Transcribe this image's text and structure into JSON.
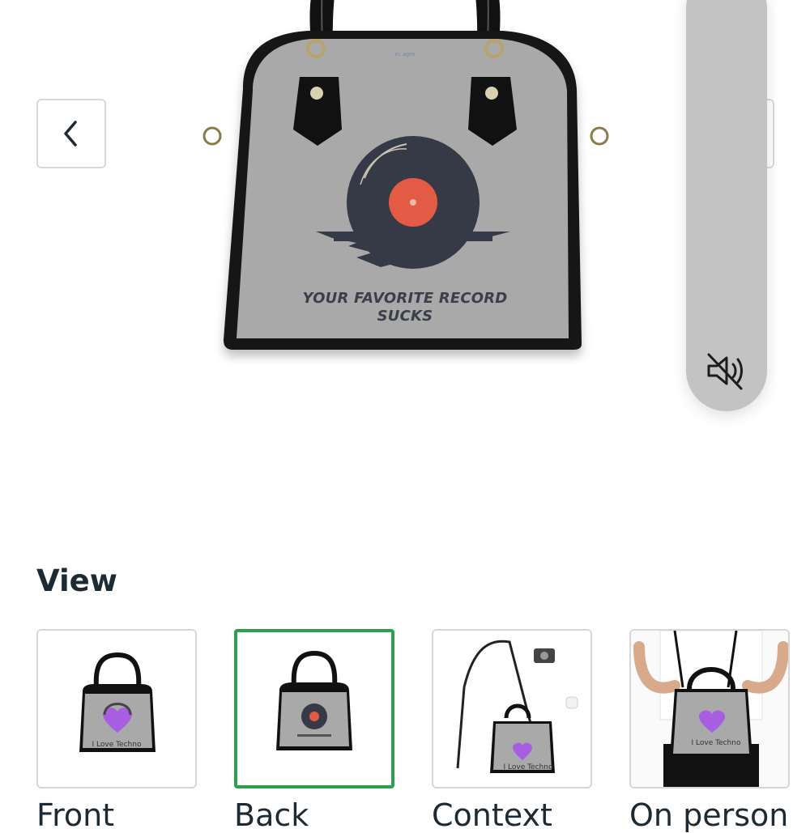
{
  "gallery": {
    "prev_icon": "chevron-left-icon",
    "next_icon": "chevron-right-icon",
    "main_image": {
      "print_lines": [
        "YOUR FAVORITE RECORD",
        "SUCKS"
      ],
      "brand_tag": "ec ages"
    },
    "video": {
      "mute_icon": "speaker-muted-icon",
      "pill_color": "#c3c3c3"
    }
  },
  "view_section": {
    "title": "View",
    "selected_color": "#2e9e4f",
    "thumbnails": [
      {
        "label": "Front",
        "print": "I Love Techno",
        "selected": false
      },
      {
        "label": "Back",
        "print": "",
        "selected": true
      },
      {
        "label": "Context",
        "print": "I Love Techno",
        "selected": false
      },
      {
        "label": "On person",
        "print": "I Love Techno",
        "selected": false
      }
    ]
  }
}
